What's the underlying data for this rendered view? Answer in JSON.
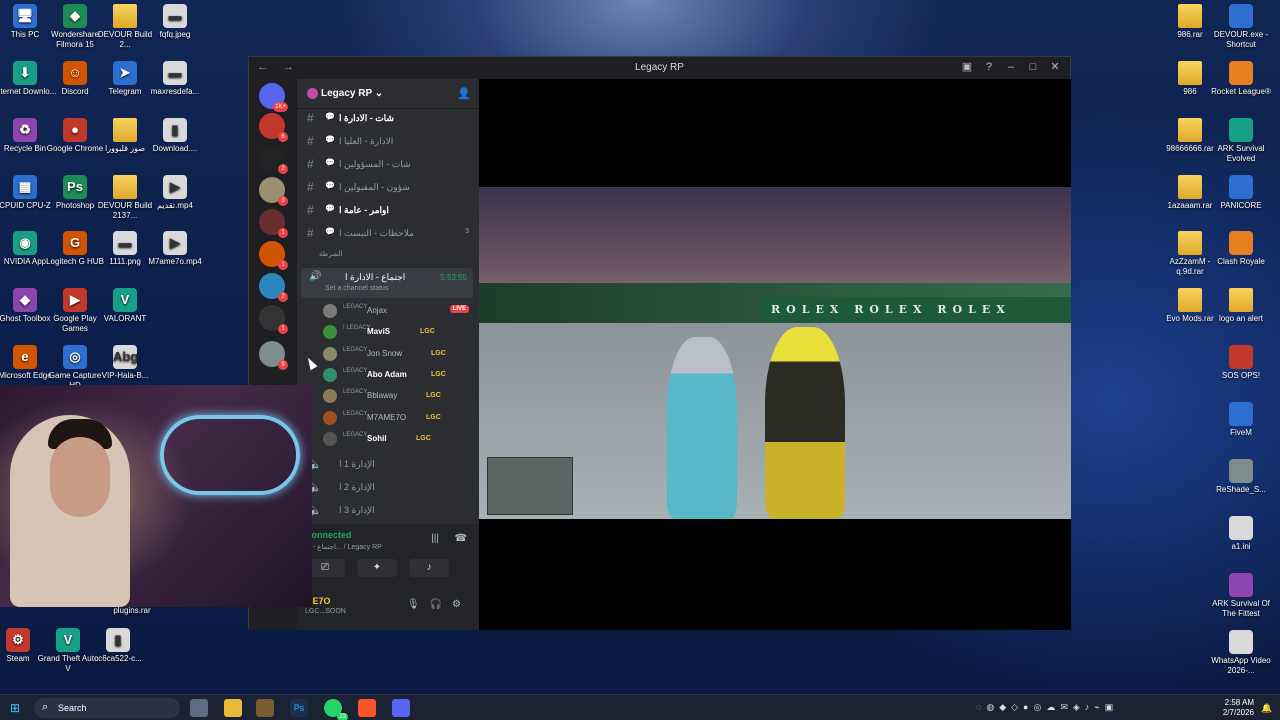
{
  "desktop": {
    "left_icons": [
      {
        "label": "This PC",
        "icon": "monitor-icon",
        "glyph": "🖥"
      },
      {
        "label": "Wondershare Filmora 15",
        "icon": "filmora-icon",
        "glyph": "◆"
      },
      {
        "label": "DEVOUR Build 2...",
        "icon": "folder-icon",
        "glyph": ""
      },
      {
        "label": "fqfq.jpeg",
        "icon": "image-file-icon",
        "glyph": "▬"
      },
      {
        "label": "Internet Downlo...",
        "icon": "idm-icon",
        "glyph": "⬇"
      },
      {
        "label": "Discord",
        "icon": "discord-icon",
        "glyph": "☺"
      },
      {
        "label": "Telegram",
        "icon": "telegram-icon",
        "glyph": "➤"
      },
      {
        "label": "maxresdefa...",
        "icon": "image-file-icon",
        "glyph": "▬"
      },
      {
        "label": "Recycle Bin",
        "icon": "recycle-bin-icon",
        "glyph": "♻"
      },
      {
        "label": "Google Chrome",
        "icon": "chrome-icon",
        "glyph": "●"
      },
      {
        "label": "صور قلبوورا",
        "icon": "folder-icon",
        "glyph": ""
      },
      {
        "label": "Download....",
        "icon": "image-file-icon",
        "glyph": "▮"
      },
      {
        "label": "CPUID CPU-Z",
        "icon": "cpuz-icon",
        "glyph": "▦"
      },
      {
        "label": "Photoshop",
        "icon": "photoshop-icon",
        "glyph": "Ps"
      },
      {
        "label": "DEVOUR Build 2137...",
        "icon": "folder-icon",
        "glyph": ""
      },
      {
        "label": "تقديم.mp4",
        "icon": "video-file-icon",
        "glyph": "▶"
      },
      {
        "label": "NVIDIA App",
        "icon": "nvidia-icon",
        "glyph": "◉"
      },
      {
        "label": "Logitech G HUB",
        "icon": "logitech-icon",
        "glyph": "G"
      },
      {
        "label": "1111.png",
        "icon": "image-file-icon",
        "glyph": "▬"
      },
      {
        "label": "M7ame7o.mp4",
        "icon": "video-file-icon",
        "glyph": "▶"
      },
      {
        "label": "Ghost Toolbox",
        "icon": "ghost-toolbox-icon",
        "glyph": "◆"
      },
      {
        "label": "Google Play Games",
        "icon": "play-games-icon",
        "glyph": "▶"
      },
      {
        "label": "VALORANT",
        "icon": "valorant-icon",
        "glyph": "V"
      },
      {
        "label": "Microsoft Edge",
        "icon": "edge-icon",
        "glyph": "e"
      },
      {
        "label": "Game Capture HD",
        "icon": "game-capture-icon",
        "glyph": "◎"
      },
      {
        "label": "VIP-Hala-B...",
        "icon": "image-file-icon",
        "glyph": "Abg"
      },
      {
        "label": "plugins.rar",
        "icon": "rar-file-icon",
        "glyph": ""
      },
      {
        "label": "Steam",
        "icon": "steam-icon",
        "glyph": "⚙"
      },
      {
        "label": "Grand Theft Auto V",
        "icon": "gta-icon",
        "glyph": "V"
      },
      {
        "label": "cc6ca522-c...",
        "icon": "image-file-icon",
        "glyph": "▮"
      }
    ],
    "right_icons": [
      {
        "label": "986.rar",
        "icon": "rar-folder-icon"
      },
      {
        "label": "DEVOUR.exe - Shortcut",
        "icon": "devour-icon"
      },
      {
        "label": "986",
        "icon": "folder-icon"
      },
      {
        "label": "Rocket League®",
        "icon": "rocket-league-icon"
      },
      {
        "label": "98666666.rar",
        "icon": "rar-folder-icon"
      },
      {
        "label": "ARK Survival Evolved",
        "icon": "ark-icon"
      },
      {
        "label": "1azaaam.rar",
        "icon": "rar-folder-icon"
      },
      {
        "label": "PANICORE",
        "icon": "panicore-icon"
      },
      {
        "label": "AzZzamM - q.9d.rar",
        "icon": "rar-folder-icon"
      },
      {
        "label": "Clash Royale",
        "icon": "clash-royale-icon"
      },
      {
        "label": "Evo Mods.rar",
        "icon": "rar-folder-icon"
      },
      {
        "label": "logo an alert",
        "icon": "folder-icon"
      },
      {
        "label": "SOS OPS!",
        "icon": "sos-ops-icon"
      },
      {
        "label": "FiveM",
        "icon": "fivem-icon"
      },
      {
        "label": "ReShade_S...",
        "icon": "reshade-icon"
      },
      {
        "label": "a1.ini",
        "icon": "ini-file-icon"
      },
      {
        "label": "ARK Survival Of The Fittest",
        "icon": "ark-icon"
      },
      {
        "label": "WhatsApp Video 2026-...",
        "icon": "video-file-icon"
      }
    ]
  },
  "discord": {
    "window_title": "Legacy RP",
    "server_name": "Legacy RP",
    "server_badges": [
      "1K+",
      "6",
      "2",
      "3",
      "1",
      "1",
      "2",
      "1",
      "9"
    ],
    "text_channels": [
      {
        "name": "شات - الادارة ا",
        "active": true,
        "count": ""
      },
      {
        "name": "الادارة - العليا ا",
        "active": false,
        "count": ""
      },
      {
        "name": "شات - المسؤولين ا",
        "active": false,
        "count": ""
      },
      {
        "name": "شؤون - المقبولين ا",
        "active": false,
        "count": ""
      },
      {
        "name": "اوامر - عامة ا",
        "active": true,
        "count": ""
      },
      {
        "name": "ملاحظات - التيست ا",
        "active": false,
        "count": "3"
      }
    ],
    "category": "الشرطة",
    "voice_channel": {
      "name": "اجتماع - الادارة ا",
      "timer": "5:53:55",
      "status_placeholder": "Set a channel status"
    },
    "members": [
      {
        "tag": "LEGACY",
        "name": "Anjax",
        "lgc": "",
        "live": "LIVE"
      },
      {
        "tag": "! LEGACY",
        "name": "MaviS",
        "lgc": "LGC",
        "live": ""
      },
      {
        "tag": "LEGACY",
        "name": "Jon Snow",
        "lgc": "LGC",
        "live": ""
      },
      {
        "tag": "LEGACY",
        "name": "Abo Adam",
        "lgc": "LGC",
        "live": ""
      },
      {
        "tag": "LEGACY",
        "name": "Bblaway",
        "lgc": "LGC",
        "live": ""
      },
      {
        "tag": "LEGACY",
        "name": "M7AME7O",
        "lgc": "LGC",
        "live": ""
      },
      {
        "tag": "LEGACY",
        "name": "Sohil",
        "lgc": "LGC",
        "live": ""
      }
    ],
    "other_voice": [
      {
        "name": "الإدارة 1 ا"
      },
      {
        "name": "الإدارة 2 ا"
      },
      {
        "name": "الإدارة 3 ا"
      }
    ],
    "connection": {
      "status": "Connected",
      "location": "اجتماع - الا... / Legacy RP"
    },
    "user": {
      "name": "ME7O",
      "status": "LGC...SOON"
    },
    "game_banner": "ROLEX ROLEX ROLEX"
  },
  "taskbar": {
    "search_placeholder": "Search",
    "time": "2:58 AM",
    "date": "2/7/2026",
    "whatsapp_badge": "23"
  }
}
